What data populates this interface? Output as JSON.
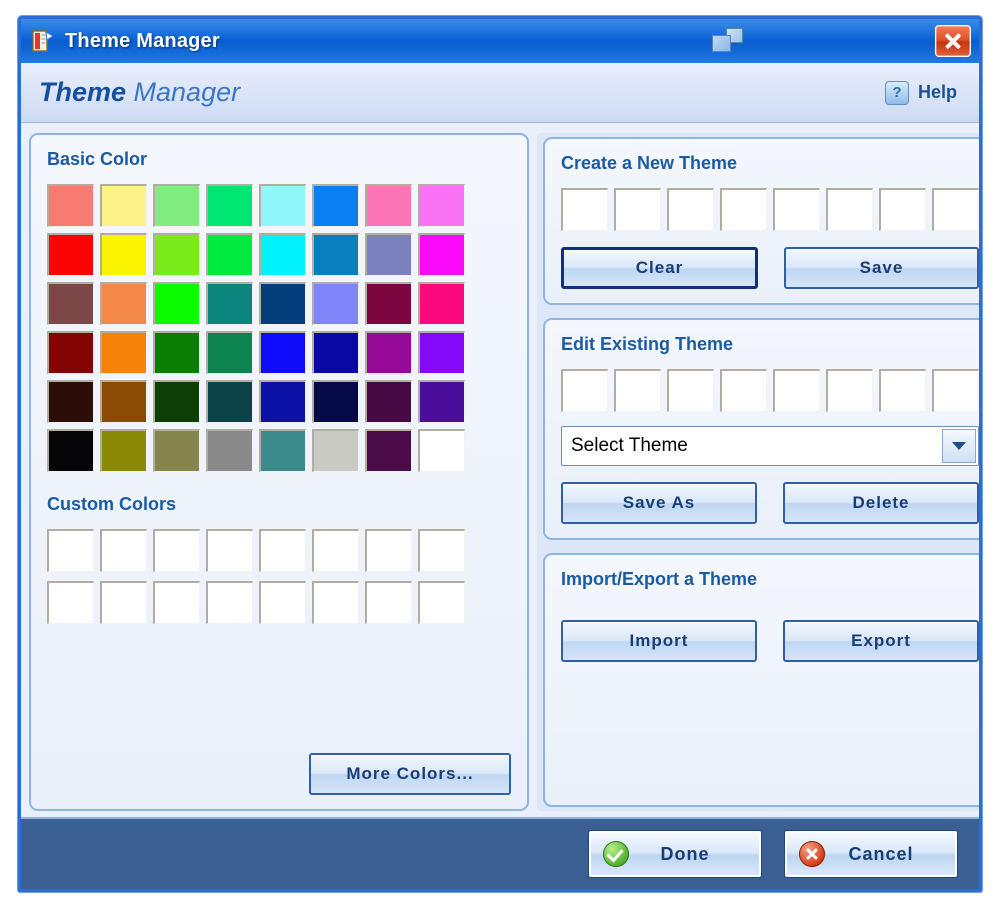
{
  "window": {
    "title": "Theme Manager",
    "app_icon": "theme-app-icon",
    "restore_icon": "restore-window-icon",
    "close_icon": "close-icon"
  },
  "header": {
    "title_bold": "Theme",
    "title_light": " Manager",
    "help_label": "Help",
    "help_icon": "?"
  },
  "basic_color": {
    "title": "Basic Color",
    "rows": [
      [
        "#f87b72",
        "#fbf389",
        "#81ed80",
        "#00e673",
        "#90f7fb",
        "#0b7ff0",
        "#fb74b6",
        "#fa72f5"
      ],
      [
        "#fc0404",
        "#fbf400",
        "#77ec19",
        "#00e93e",
        "#00f3fb",
        "#0a7fbd",
        "#7a81bc",
        "#fb09fb"
      ],
      [
        "#7c4747",
        "#f3884a",
        "#0afa00",
        "#0c857f",
        "#053e7c",
        "#7f84f8",
        "#7c0740",
        "#fb0a7f"
      ],
      [
        "#840402",
        "#f78209",
        "#0a7d03",
        "#0d8350",
        "#0d0bf9",
        "#0a08a5",
        "#950b97",
        "#8309f8"
      ],
      [
        "#2c0d07",
        "#8c4a07",
        "#0c3e06",
        "#0c4348",
        "#0b11a4",
        "#050a47",
        "#470a45",
        "#4a0e9b"
      ],
      [
        "#060508",
        "#8a8a07",
        "#85854d",
        "#8a8a8a",
        "#3c8a8a",
        "#c8cac3",
        "#4c0c49",
        "#ffffff"
      ]
    ]
  },
  "custom_colors": {
    "title": "Custom Colors",
    "row_count": 2,
    "per_row": 8,
    "more_colors_label": "More Colors..."
  },
  "create_theme": {
    "title": "Create a New Theme",
    "swatch_count": 8,
    "clear_label": "Clear",
    "save_label": "Save"
  },
  "edit_theme": {
    "title": "Edit Existing Theme",
    "swatch_count": 8,
    "select_value": "Select Theme",
    "save_as_label": "Save As",
    "delete_label": "Delete"
  },
  "import_export": {
    "title": "Import/Export a Theme",
    "import_label": "Import",
    "export_label": "Export"
  },
  "footer": {
    "done_label": "Done",
    "cancel_label": "Cancel",
    "done_icon": "check-circle-icon",
    "cancel_icon": "x-circle-icon"
  }
}
